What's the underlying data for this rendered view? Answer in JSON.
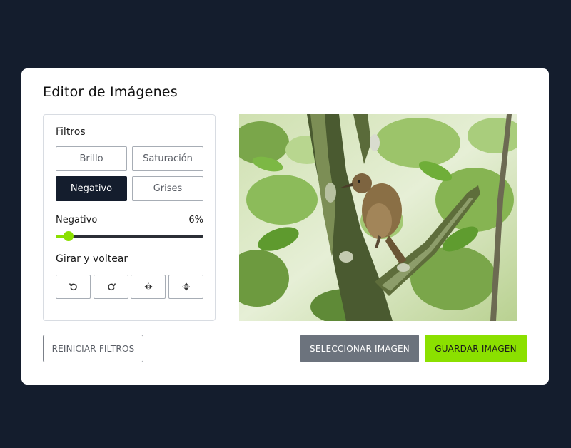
{
  "app": {
    "title": "Editor de Imágenes"
  },
  "filters": {
    "heading": "Filtros",
    "buttons": [
      {
        "label": "Brillo",
        "active": false
      },
      {
        "label": "Saturación",
        "active": false
      },
      {
        "label": "Negativo",
        "active": true
      },
      {
        "label": "Grises",
        "active": false
      }
    ]
  },
  "slider": {
    "name": "Negativo",
    "value_label": "6%",
    "value": 6,
    "max": 100
  },
  "rotate": {
    "heading": "Girar y voltear",
    "buttons": [
      {
        "icon": "rotate-left-icon"
      },
      {
        "icon": "rotate-right-icon"
      },
      {
        "icon": "flip-horizontal-icon"
      },
      {
        "icon": "flip-vertical-icon"
      }
    ]
  },
  "actions": {
    "reset_label": "REINICIAR FILTROS",
    "select_label": "SELECCIONAR IMAGEN",
    "save_label": "GUARDAR IMAGEN"
  },
  "colors": {
    "background": "#141d2d",
    "accent": "#8be000",
    "active_filter": "#141d2d",
    "select_button": "#6c737d"
  }
}
